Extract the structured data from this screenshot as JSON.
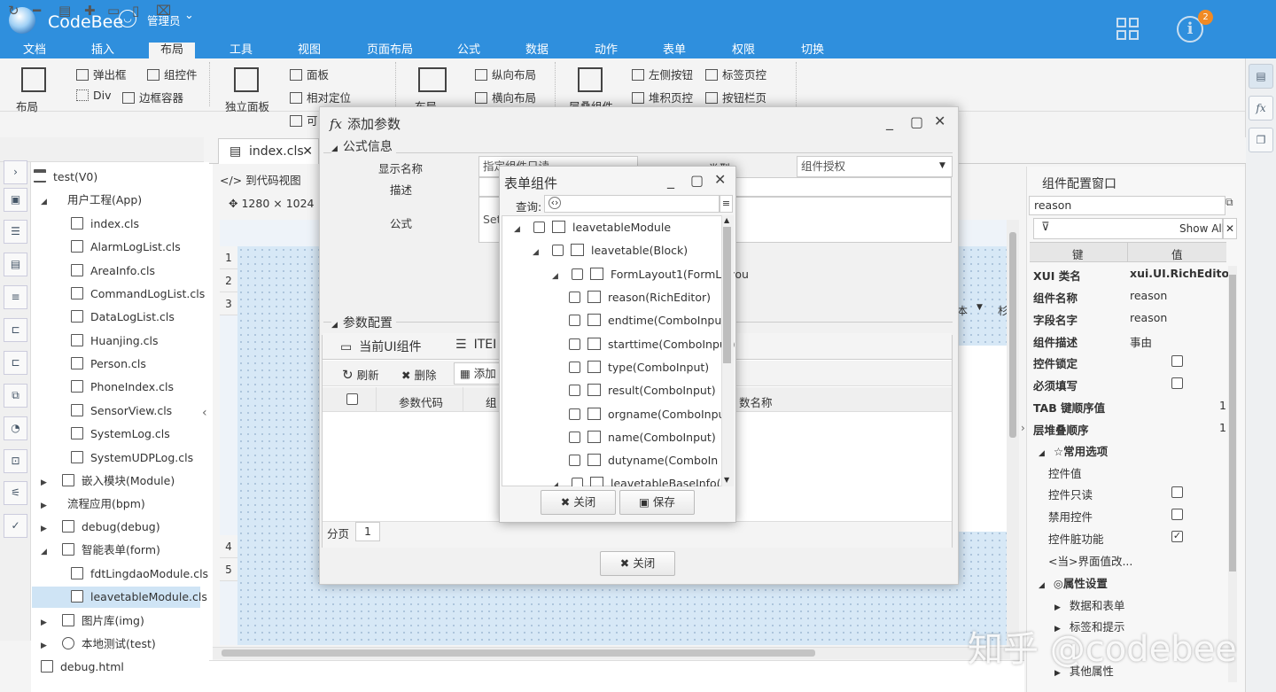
{
  "header": {
    "app_name": "CodeBee",
    "user": "管理员",
    "notification_count": "2",
    "menu": [
      "文档",
      "插入",
      "布局",
      "工具",
      "视图",
      "页面布局",
      "公式",
      "数据",
      "动作",
      "表单",
      "权限",
      "切换"
    ],
    "active_menu": "布局"
  },
  "ribbon": {
    "layout": "布局",
    "popup": "弹出框",
    "component": "组控件",
    "div": "Div",
    "border_container": "边框容器",
    "independent_panel": "独立面板",
    "panel": "面板",
    "relative": "相对定位",
    "maybe": "可",
    "layout2": "布局",
    "vertical_layout": "纵向布局",
    "horizontal_layout": "横向布局",
    "stacked_component": "层叠组件",
    "left_button": "左侧按钮",
    "tab_page": "标签页控",
    "stacked_page": "堆积页控",
    "button_bar": "按钮栏页"
  },
  "tree": {
    "root": "test(V0)",
    "items": [
      {
        "label": "用户工程(App)"
      },
      {
        "label": "index.cls"
      },
      {
        "label": "AlarmLogList.cls"
      },
      {
        "label": "AreaInfo.cls"
      },
      {
        "label": "CommandLogList.cls"
      },
      {
        "label": "DataLogList.cls"
      },
      {
        "label": "Huanjing.cls"
      },
      {
        "label": "Person.cls"
      },
      {
        "label": "PhoneIndex.cls"
      },
      {
        "label": "SensorView.cls"
      },
      {
        "label": "SystemLog.cls"
      },
      {
        "label": "SystemUDPLog.cls"
      },
      {
        "label": "嵌入模块(Module)"
      },
      {
        "label": "流程应用(bpm)"
      },
      {
        "label": "debug(debug)"
      },
      {
        "label": "智能表单(form)"
      },
      {
        "label": "fdtLingdaoModule.cls"
      },
      {
        "label": "leavetableModule.cls"
      },
      {
        "label": "图片库(img)"
      },
      {
        "label": "本地测试(test)"
      },
      {
        "label": "debug.html"
      }
    ]
  },
  "workspace": {
    "file_tab": "index.cls",
    "code_view": "到代码视图",
    "resolution": "1280 × 1024",
    "row_numbers": [
      "1",
      "2",
      "3",
      "4",
      "5"
    ],
    "ruler_frag1": "本",
    "ruler_frag2": "杉"
  },
  "config_panel": {
    "title": "组件配置窗口",
    "search_value": "reason",
    "show_all": "Show All",
    "col_key": "键",
    "col_value": "值",
    "rows": [
      {
        "key": "XUI 类名",
        "value": "xui.UI.RichEditor"
      },
      {
        "key": "组件名称",
        "value": "reason"
      },
      {
        "key": "字段名字",
        "value": "reason"
      },
      {
        "key": "组件描述",
        "value": "事由"
      },
      {
        "key": "控件锁定",
        "value": ""
      },
      {
        "key": "必须填写",
        "value": ""
      },
      {
        "key": "TAB 键顺序值",
        "value": "1"
      },
      {
        "key": "层堆叠顺序",
        "value": "1"
      }
    ],
    "common_section": "☆常用选项",
    "common_rows": [
      {
        "key": "控件值"
      },
      {
        "key": "控件只读"
      },
      {
        "key": "禁用控件"
      },
      {
        "key": "控件脏功能",
        "checked": true
      },
      {
        "key": "<当>界面值改..."
      }
    ],
    "props_section": "属性设置",
    "props_rows": [
      "数据和表单",
      "标签和提示",
      "其他属性"
    ]
  },
  "dialog_add_param": {
    "title": "添加参数",
    "formula_section": "公式信息",
    "display_name_label": "显示名称",
    "display_name_value": "指定组件只读",
    "type_label": "类型",
    "type_value": "组件授权",
    "desc_label": "描述",
    "formula_label": "公式",
    "formula_value": "Set",
    "param_section": "参数配置",
    "tab_current_ui": "当前UI组件",
    "tab_item": "ITEI",
    "refresh": "刷新",
    "delete": "删除",
    "add": "添加",
    "col_code": "参数代码",
    "col_group": "组",
    "col_name": "数名称",
    "pager_label": "分页",
    "pager_value": "1",
    "close": "关闭"
  },
  "dialog_form_component": {
    "title": "表单组件",
    "query_label": "查询:",
    "nodes": [
      {
        "label": "leavetableModule"
      },
      {
        "label": "leavetable(Block)"
      },
      {
        "label": "FormLayout1(FormLayou"
      },
      {
        "label": "reason(RichEditor)"
      },
      {
        "label": "endtime(ComboInput)"
      },
      {
        "label": "starttime(ComboInput)"
      },
      {
        "label": "type(ComboInput)"
      },
      {
        "label": "result(ComboInput)"
      },
      {
        "label": "orgname(ComboInput)"
      },
      {
        "label": "name(ComboInput)"
      },
      {
        "label": "dutyname(ComboInput"
      },
      {
        "label": "leavetableBaseInfo(Blo"
      }
    ],
    "close": "关闭",
    "save": "保存"
  },
  "watermark": "知乎 @codebee"
}
